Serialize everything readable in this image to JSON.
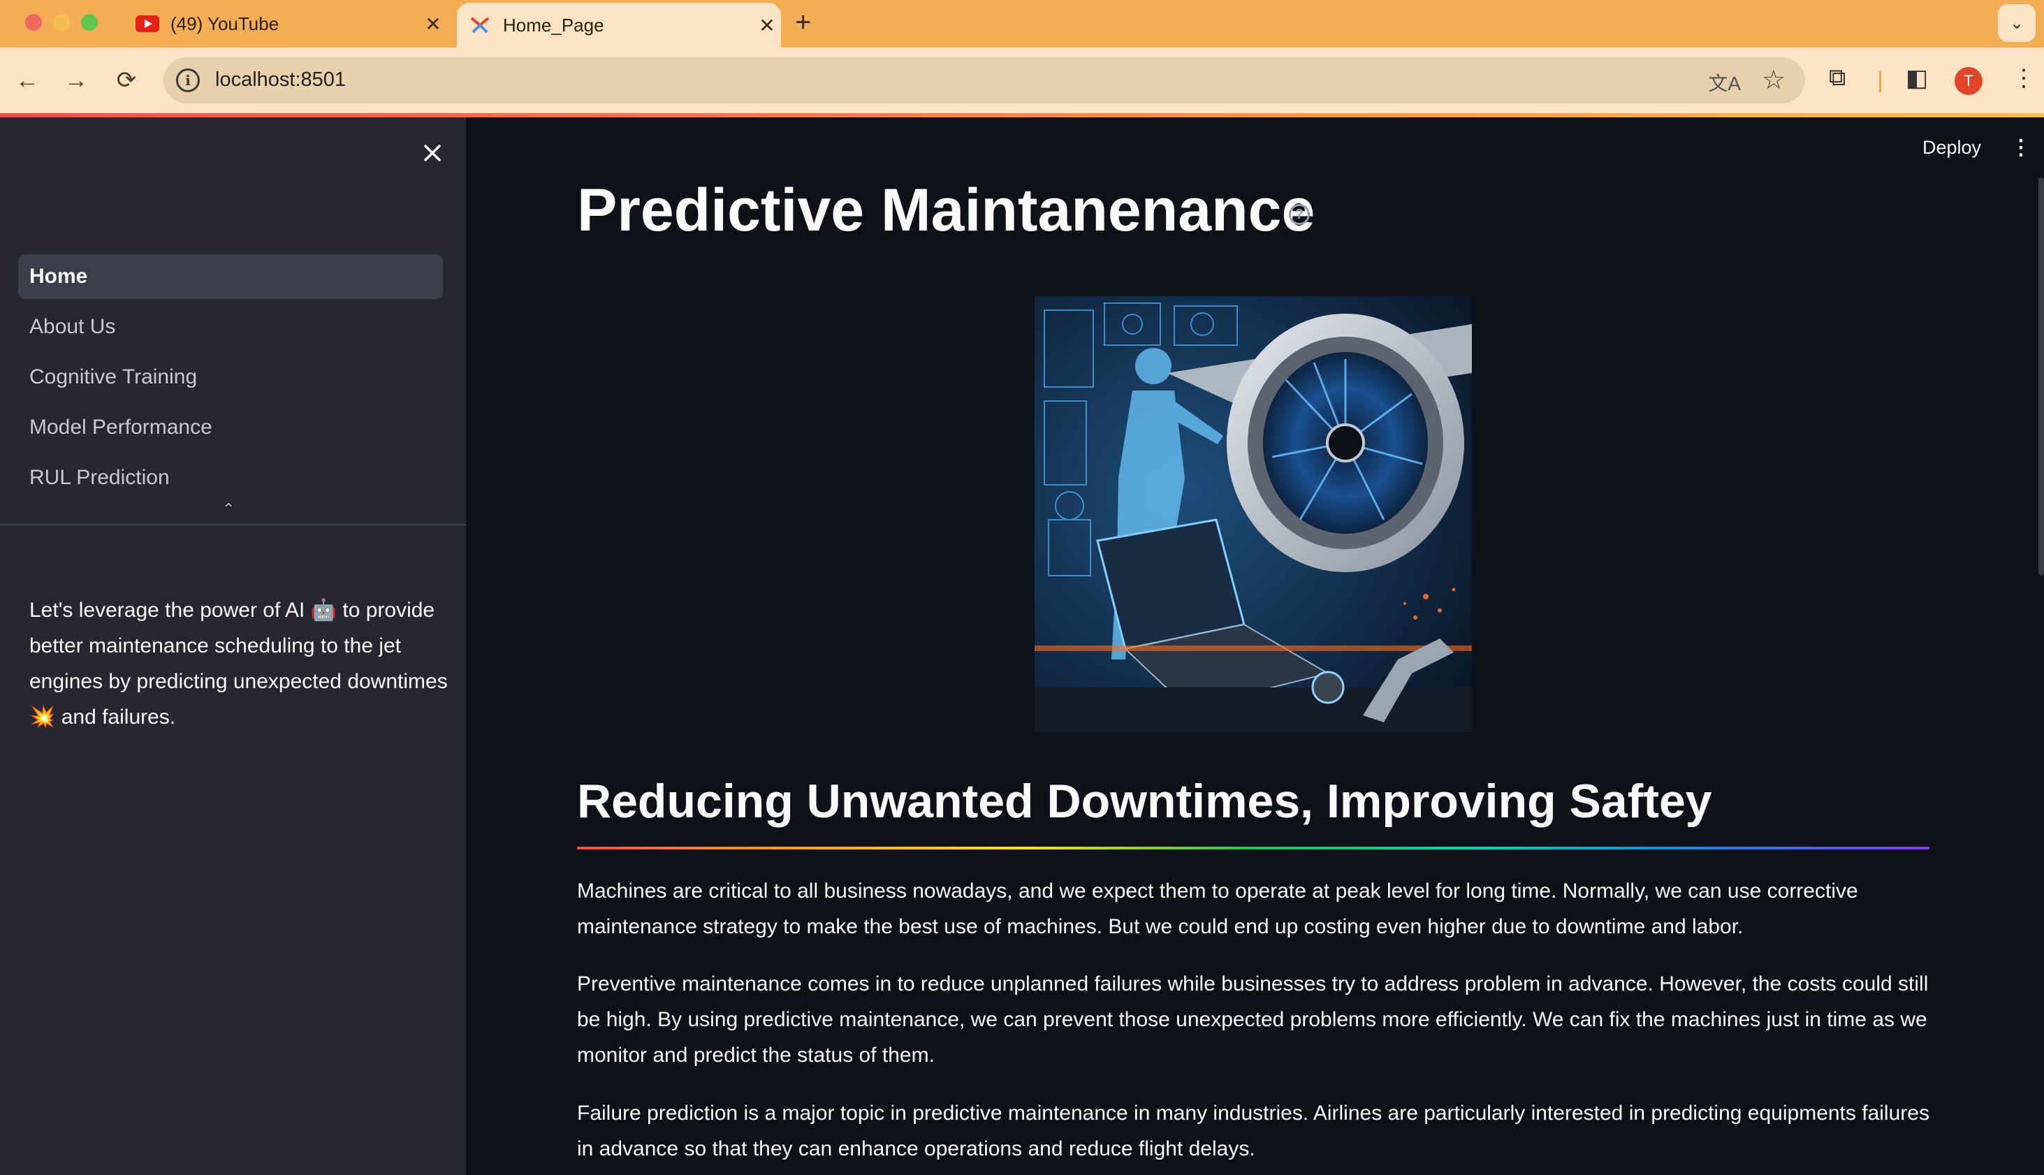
{
  "browser": {
    "tabs": [
      {
        "title": "(49) YouTube",
        "icon": "youtube-icon"
      },
      {
        "title": "Home_Page",
        "icon": "streamlit-icon"
      }
    ],
    "new_tab_label": "+",
    "url": "localhost:8501",
    "profile_initial": "T",
    "accent_color": "#f2ad55"
  },
  "sidebar": {
    "nav_items": [
      {
        "label": "Home",
        "active": true
      },
      {
        "label": "About Us",
        "active": false
      },
      {
        "label": "Cognitive Training",
        "active": false
      },
      {
        "label": "Model Performance",
        "active": false
      },
      {
        "label": "RUL Prediction",
        "active": false
      }
    ],
    "description_part1": "Let's leverage the power of AI",
    "emoji_robot": "🤖",
    "description_part2": "to provide better maintenance scheduling to the jet engines by predicting unexpected downtimes",
    "emoji_collision": "💥",
    "description_part3": "and failures."
  },
  "header": {
    "deploy_label": "Deploy"
  },
  "main": {
    "title": "Predictive Maintanenance",
    "section_heading": "Reducing Unwanted Downtimes, Improving Saftey",
    "paragraphs": [
      "Machines are critical to all business nowadays, and we expect them to operate at peak level for long time. Normally, we can use corrective maintenance strategy to make the best use of machines. But we could end up costing even higher due to downtime and labor.",
      "Preventive maintenance comes in to reduce unplanned failures while businesses try to address problem in advance. However, the costs could still be high. By using predictive maintenance, we can prevent those unexpected problems more efficiently. We can fix the machines just in time as we monitor and predict the status of them.",
      "Failure prediction is a major topic in predictive maintenance in many industries. Airlines are particularly interested in predicting equipments failures in advance so that they can enhance operations and reduce flight delays."
    ]
  }
}
